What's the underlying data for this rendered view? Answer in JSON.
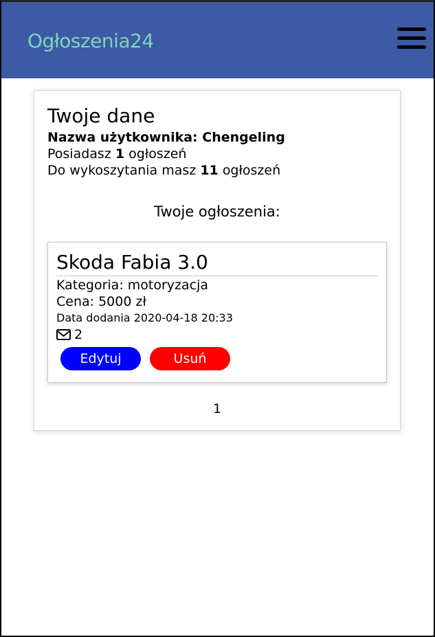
{
  "navbar": {
    "brand": "Ogłoszenia24",
    "menu_icon": "hamburger-menu-icon",
    "background": "#3d5aa6",
    "brand_color": "#7dd6b6"
  },
  "profile": {
    "title": "Twoje dane",
    "username_label": "Nazwa użytkownika:",
    "username": "Chengeling",
    "owned_prefix": "Posiadasz",
    "owned_count": "1",
    "owned_suffix": "ogłoszeń",
    "remaining_prefix": "Do wykoszytania masz",
    "remaining_count": "11",
    "remaining_suffix": "ogłoszeń"
  },
  "listings": {
    "section_title": "Twoje ogłoszenia:",
    "items": [
      {
        "title": "Skoda Fabia 3.0",
        "category_label": "Kategoria:",
        "category": "motoryzacja",
        "price_label": "Cena:",
        "price": "5000 zł",
        "date_label": "Data dodania",
        "date": "2020-04-18 20:33",
        "messages_icon": "envelope-icon",
        "messages_count": "2",
        "edit_label": "Edytuj",
        "delete_label": "Usuń"
      }
    ]
  },
  "pagination": {
    "current_page": "1"
  },
  "colors": {
    "edit_button": "#0000ff",
    "delete_button": "#ff0000"
  }
}
